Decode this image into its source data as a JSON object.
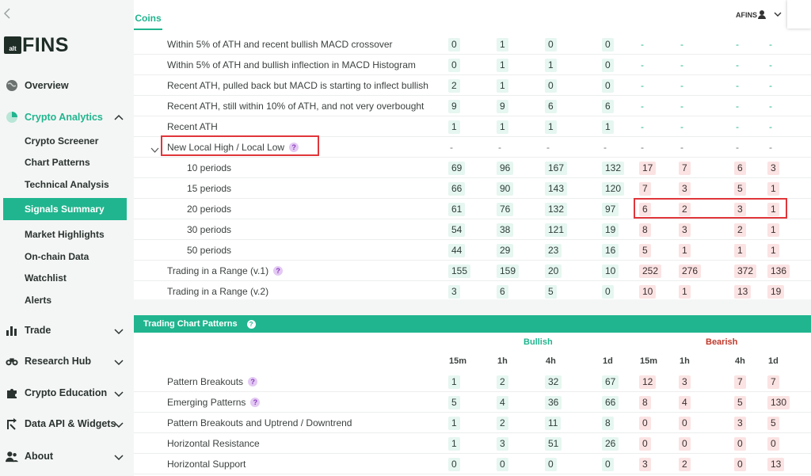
{
  "sidebar": {
    "back_icon": "chevron-left-icon",
    "logo_mark": "alt",
    "logo_text": "FINS",
    "items": [
      {
        "label": "Overview",
        "icon": "globe-icon"
      },
      {
        "label": "Crypto Analytics",
        "icon": "pie-chart-icon"
      },
      {
        "label": "Trade",
        "icon": "bar-chart-icon"
      },
      {
        "label": "Research Hub",
        "icon": "binoculars-icon"
      },
      {
        "label": "Crypto Education",
        "icon": "puzzle-icon"
      },
      {
        "label": "Data API & Widgets",
        "icon": "api-arrow-icon"
      },
      {
        "label": "About",
        "icon": "users-icon"
      }
    ],
    "sub_items": [
      "Crypto Screener",
      "Chart Patterns",
      "Technical Analysis",
      "Signals Summary",
      "Market Highlights",
      "On-chain Data",
      "Watchlist",
      "Alerts"
    ],
    "active_sub": "Signals Summary"
  },
  "header": {
    "tab": "Coins",
    "user": "AFINS"
  },
  "signals_rows": [
    {
      "label": "Within 5% of ATH and recent bullish MACD crossover",
      "values": [
        "0",
        "1",
        "0",
        "0",
        "-",
        "-",
        "-",
        "-"
      ]
    },
    {
      "label": "Within 5% of ATH and bullish inflection in MACD Histogram",
      "values": [
        "0",
        "1",
        "1",
        "0",
        "-",
        "-",
        "-",
        "-"
      ]
    },
    {
      "label": "Recent ATH, pulled back but MACD is starting to inflect bullish",
      "values": [
        "2",
        "1",
        "0",
        "0",
        "-",
        "-",
        "-",
        "-"
      ]
    },
    {
      "label": "Recent ATH, still within 10% of ATH, and not very overbought",
      "values": [
        "9",
        "9",
        "6",
        "6",
        "-",
        "-",
        "-",
        "-"
      ]
    },
    {
      "label": "Recent ATH",
      "values": [
        "1",
        "1",
        "1",
        "1",
        "-",
        "-",
        "-",
        "-"
      ]
    },
    {
      "label": "New Local High / Local Low",
      "values": [
        "-",
        "-",
        "-",
        "-",
        "-",
        "-",
        "-",
        "-"
      ],
      "help": true,
      "group": true
    },
    {
      "label": "10 periods",
      "values": [
        "69",
        "96",
        "167",
        "132",
        "17",
        "7",
        "6",
        "3"
      ],
      "indent": true
    },
    {
      "label": "15 periods",
      "values": [
        "66",
        "90",
        "143",
        "120",
        "7",
        "3",
        "5",
        "1"
      ],
      "indent": true
    },
    {
      "label": "20 periods",
      "values": [
        "61",
        "76",
        "132",
        "97",
        "6",
        "2",
        "3",
        "1"
      ],
      "indent": true
    },
    {
      "label": "30 periods",
      "values": [
        "54",
        "38",
        "121",
        "19",
        "8",
        "3",
        "2",
        "1"
      ],
      "indent": true
    },
    {
      "label": "50 periods",
      "values": [
        "44",
        "29",
        "23",
        "16",
        "5",
        "1",
        "1",
        "1"
      ],
      "indent": true
    },
    {
      "label": "Trading in a Range (v.1)",
      "values": [
        "155",
        "159",
        "20",
        "10",
        "252",
        "276",
        "372",
        "136"
      ],
      "help": true
    },
    {
      "label": "Trading in a Range (v.2)",
      "values": [
        "3",
        "6",
        "5",
        "0",
        "10",
        "1",
        "13",
        "19"
      ]
    }
  ],
  "patterns": {
    "title": "Trading Chart Patterns",
    "bullish_label": "Bullish",
    "bearish_label": "Bearish",
    "columns": [
      "15m",
      "1h",
      "4h",
      "1d",
      "15m",
      "1h",
      "4h",
      "1d"
    ],
    "rows": [
      {
        "label": "Pattern Breakouts",
        "values": [
          "1",
          "2",
          "32",
          "67",
          "12",
          "3",
          "7",
          "7"
        ],
        "help": true
      },
      {
        "label": "Emerging Patterns",
        "values": [
          "5",
          "4",
          "36",
          "66",
          "8",
          "4",
          "5",
          "130"
        ],
        "help": true
      },
      {
        "label": "Pattern Breakouts and Uptrend / Downtrend",
        "values": [
          "1",
          "2",
          "11",
          "8",
          "0",
          "0",
          "3",
          "5"
        ]
      },
      {
        "label": "Horizontal Resistance",
        "values": [
          "1",
          "3",
          "51",
          "26",
          "0",
          "0",
          "0",
          "0"
        ]
      },
      {
        "label": "Horizontal Support",
        "values": [
          "0",
          "0",
          "0",
          "0",
          "3",
          "2",
          "0",
          "13"
        ]
      }
    ]
  },
  "colors": {
    "accent": "#20b58e",
    "bearish": "#c0392b",
    "highlight": "#e0363a"
  }
}
